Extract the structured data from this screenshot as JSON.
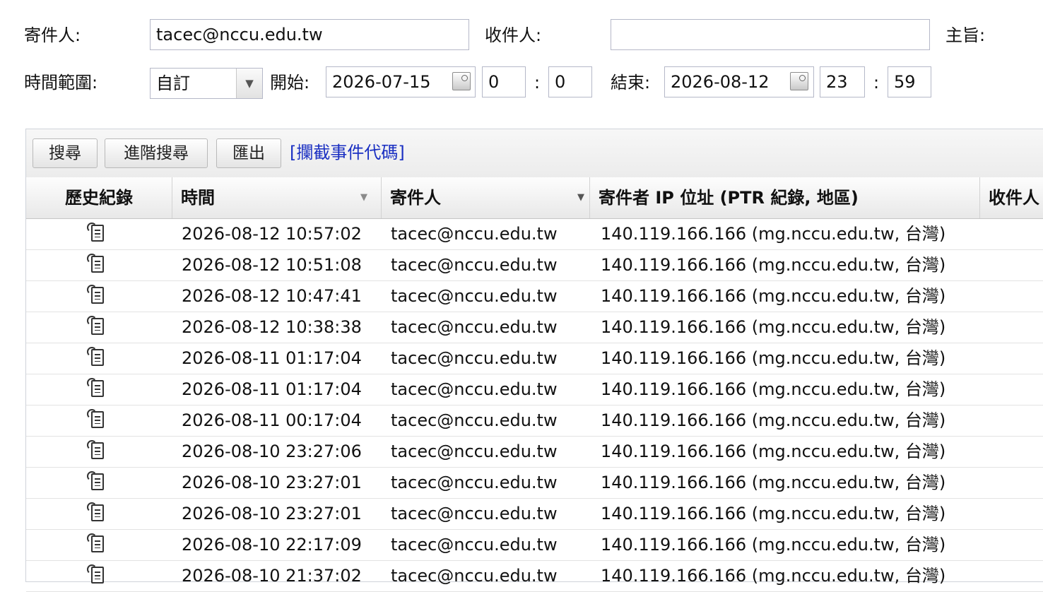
{
  "filters": {
    "sender_label": "寄件人:",
    "sender_value": "tacec@nccu.edu.tw",
    "recipient_label": "收件人:",
    "recipient_value": "",
    "subject_label": "主旨:",
    "time_range_label": "時間範圍:",
    "time_range_value": "自訂",
    "start_label": "開始:",
    "start_date": "2026-07-15",
    "start_hour": "0",
    "start_minute": "0",
    "end_label": "結束:",
    "end_date": "2026-08-12",
    "end_hour": "23",
    "end_minute": "59",
    "colon": ":"
  },
  "toolbar": {
    "search_label": "搜尋",
    "advanced_search_label": "進階搜尋",
    "export_label": "匯出",
    "block_codes_link": "[攔截事件代碼]"
  },
  "table": {
    "columns": [
      "歷史紀錄",
      "時間",
      "寄件人",
      "寄件者 IP 位址 (PTR 紀錄, 地區)",
      "收件人"
    ],
    "rows": [
      {
        "time": "2026-08-12 10:57:02",
        "sender": "tacec@nccu.edu.tw",
        "ip": "140.119.166.166 (mg.nccu.edu.tw, 台灣)"
      },
      {
        "time": "2026-08-12 10:51:08",
        "sender": "tacec@nccu.edu.tw",
        "ip": "140.119.166.166 (mg.nccu.edu.tw, 台灣)"
      },
      {
        "time": "2026-08-12 10:47:41",
        "sender": "tacec@nccu.edu.tw",
        "ip": "140.119.166.166 (mg.nccu.edu.tw, 台灣)"
      },
      {
        "time": "2026-08-12 10:38:38",
        "sender": "tacec@nccu.edu.tw",
        "ip": "140.119.166.166 (mg.nccu.edu.tw, 台灣)"
      },
      {
        "time": "2026-08-11 01:17:04",
        "sender": "tacec@nccu.edu.tw",
        "ip": "140.119.166.166 (mg.nccu.edu.tw, 台灣)"
      },
      {
        "time": "2026-08-11 01:17:04",
        "sender": "tacec@nccu.edu.tw",
        "ip": "140.119.166.166 (mg.nccu.edu.tw, 台灣)"
      },
      {
        "time": "2026-08-11 00:17:04",
        "sender": "tacec@nccu.edu.tw",
        "ip": "140.119.166.166 (mg.nccu.edu.tw, 台灣)"
      },
      {
        "time": "2026-08-10 23:27:06",
        "sender": "tacec@nccu.edu.tw",
        "ip": "140.119.166.166 (mg.nccu.edu.tw, 台灣)"
      },
      {
        "time": "2026-08-10 23:27:01",
        "sender": "tacec@nccu.edu.tw",
        "ip": "140.119.166.166 (mg.nccu.edu.tw, 台灣)"
      },
      {
        "time": "2026-08-10 23:27:01",
        "sender": "tacec@nccu.edu.tw",
        "ip": "140.119.166.166 (mg.nccu.edu.tw, 台灣)"
      },
      {
        "time": "2026-08-10 22:17:09",
        "sender": "tacec@nccu.edu.tw",
        "ip": "140.119.166.166 (mg.nccu.edu.tw, 台灣)"
      },
      {
        "time": "2026-08-10 21:37:02",
        "sender": "tacec@nccu.edu.tw",
        "ip": "140.119.166.166 (mg.nccu.edu.tw, 台灣)"
      }
    ]
  },
  "icons": {
    "history": "history-icon",
    "dropdown": "chevron-down-icon",
    "calendar": "calendar-icon",
    "sort": "sort-arrow-icon"
  },
  "colors": {
    "link": "#1a2fc2",
    "field_border": "#b5b8c8"
  }
}
